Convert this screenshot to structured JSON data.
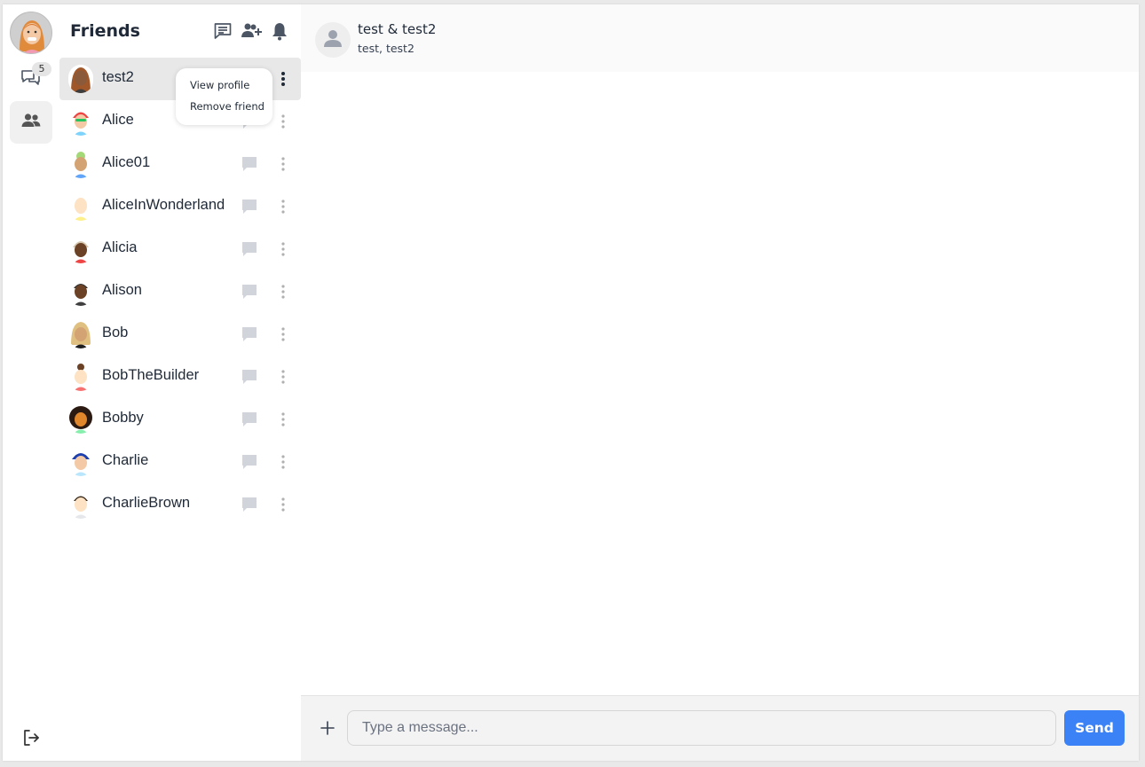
{
  "rail": {
    "unread_badge": "5",
    "accent": "#3b82f6"
  },
  "friends_panel": {
    "title": "Friends",
    "header_icons": [
      "new-chat-icon",
      "add-friend-icon",
      "bell-icon"
    ],
    "items": [
      {
        "name": "test2",
        "selected": true
      },
      {
        "name": "Alice"
      },
      {
        "name": "Alice01"
      },
      {
        "name": "AliceInWonderland"
      },
      {
        "name": "Alicia"
      },
      {
        "name": "Alison"
      },
      {
        "name": "Bob"
      },
      {
        "name": "BobTheBuilder"
      },
      {
        "name": "Bobby"
      },
      {
        "name": "Charlie"
      },
      {
        "name": "CharlieBrown"
      }
    ],
    "context_menu": {
      "view_profile": "View profile",
      "remove_friend": "Remove friend"
    }
  },
  "chat": {
    "title": "test & test2",
    "participants": "test, test2",
    "composer": {
      "placeholder": "Type a message...",
      "value": "",
      "send_label": "Send"
    }
  }
}
